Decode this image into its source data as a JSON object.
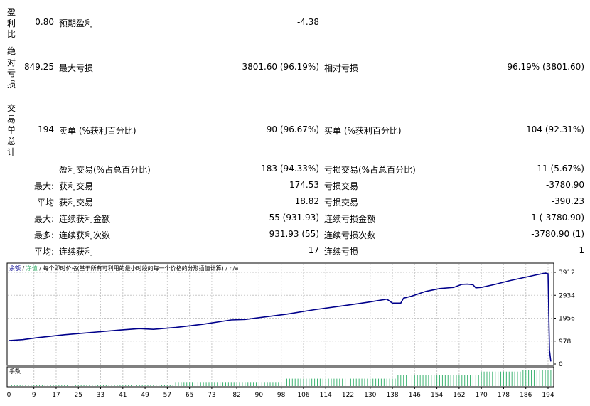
{
  "stats": {
    "rows": [
      {
        "left_label": "盈利比",
        "left_value": "0.80",
        "mid_label": "预期盈利",
        "mid_value": "-4.38",
        "right_label": "",
        "right_value": ""
      },
      {
        "left_label": "绝对亏损",
        "left_value": "849.25",
        "mid_label": "最大亏损",
        "mid_value": "3801.60 (96.19%)",
        "right_label": "相对亏损",
        "right_value": "96.19% (3801.60)"
      },
      {
        "left_label": "交易单总计",
        "left_value": "194",
        "mid_label": "卖单 (%获利百分比)",
        "mid_value": "90 (96.67%)",
        "right_label": "买单 (%获利百分比)",
        "right_value": "104 (92.31%)"
      },
      {
        "left_label": "",
        "left_value": "",
        "mid_label": "盈利交易(%占总百分比)",
        "mid_value": "183 (94.33%)",
        "right_label": "亏损交易(%占总百分比)",
        "right_value": "11 (5.67%)"
      },
      {
        "left_label": "",
        "left_value": "最大:",
        "mid_label": "获利交易",
        "mid_value": "174.53",
        "right_label": "亏损交易",
        "right_value": "-3780.90"
      },
      {
        "left_label": "",
        "left_value": "平均",
        "mid_label": "获利交易",
        "mid_value": "18.82",
        "right_label": "亏损交易",
        "right_value": "-390.23"
      },
      {
        "left_label": "",
        "left_value": "最大:",
        "mid_label": "连续获利金额",
        "mid_value": "55 (931.93)",
        "right_label": "连续亏损金额",
        "right_value": "1 (-3780.90)"
      },
      {
        "left_label": "",
        "left_value": "最多:",
        "mid_label": "连续获利次数",
        "mid_value": "931.93 (55)",
        "right_label": "连续亏损次数",
        "right_value": "-3780.90 (1)"
      },
      {
        "left_label": "",
        "left_value": "平均:",
        "mid_label": "连续获利",
        "mid_value": "17",
        "right_label": "连续亏损",
        "right_value": "1"
      }
    ]
  },
  "chart_data": {
    "type": "line",
    "legend": [
      "余额",
      "净值",
      "每个即时价格(基于所有可利用的最小时段的每一个价格的分形插值计算)",
      "n/a"
    ],
    "lower_panel_label": "手数",
    "x_ticks": [
      0,
      9,
      17,
      25,
      33,
      41,
      49,
      57,
      65,
      73,
      82,
      90,
      98,
      106,
      114,
      122,
      130,
      138,
      146,
      154,
      162,
      170,
      178,
      186,
      194
    ],
    "y_ticks": [
      3912,
      2934,
      1956,
      978,
      0
    ],
    "ylim": [
      0,
      3912
    ],
    "xlim": [
      0,
      196
    ],
    "colors": {
      "balance": "#00008b",
      "volume": "#3cb371",
      "grid": "#c8c8c8",
      "frame": "#000000"
    },
    "series": [
      {
        "name": "余额",
        "x": [
          0,
          5,
          10,
          20,
          30,
          40,
          47,
          52,
          60,
          70,
          80,
          85,
          100,
          110,
          120,
          130,
          136,
          138,
          141,
          142,
          145,
          150,
          155,
          160,
          163,
          165,
          167,
          168,
          170,
          175,
          180,
          190,
          193,
          194,
          194.5,
          195
        ],
        "values": [
          1000,
          1040,
          1120,
          1250,
          1350,
          1450,
          1510,
          1480,
          1560,
          1700,
          1880,
          1900,
          2130,
          2320,
          2480,
          2650,
          2770,
          2600,
          2600,
          2810,
          2900,
          3100,
          3220,
          3270,
          3400,
          3410,
          3380,
          3250,
          3270,
          3400,
          3550,
          3810,
          3880,
          3850,
          600,
          110
        ]
      }
    ],
    "volume": {
      "x_start": 1,
      "x_end": 195,
      "steps": [
        {
          "from": 1,
          "level": 0.06
        },
        {
          "from": 60,
          "level": 0.22
        },
        {
          "from": 100,
          "level": 0.4
        },
        {
          "from": 140,
          "level": 0.6
        },
        {
          "from": 170,
          "level": 0.78
        },
        {
          "from": 185,
          "level": 0.85
        }
      ]
    }
  }
}
